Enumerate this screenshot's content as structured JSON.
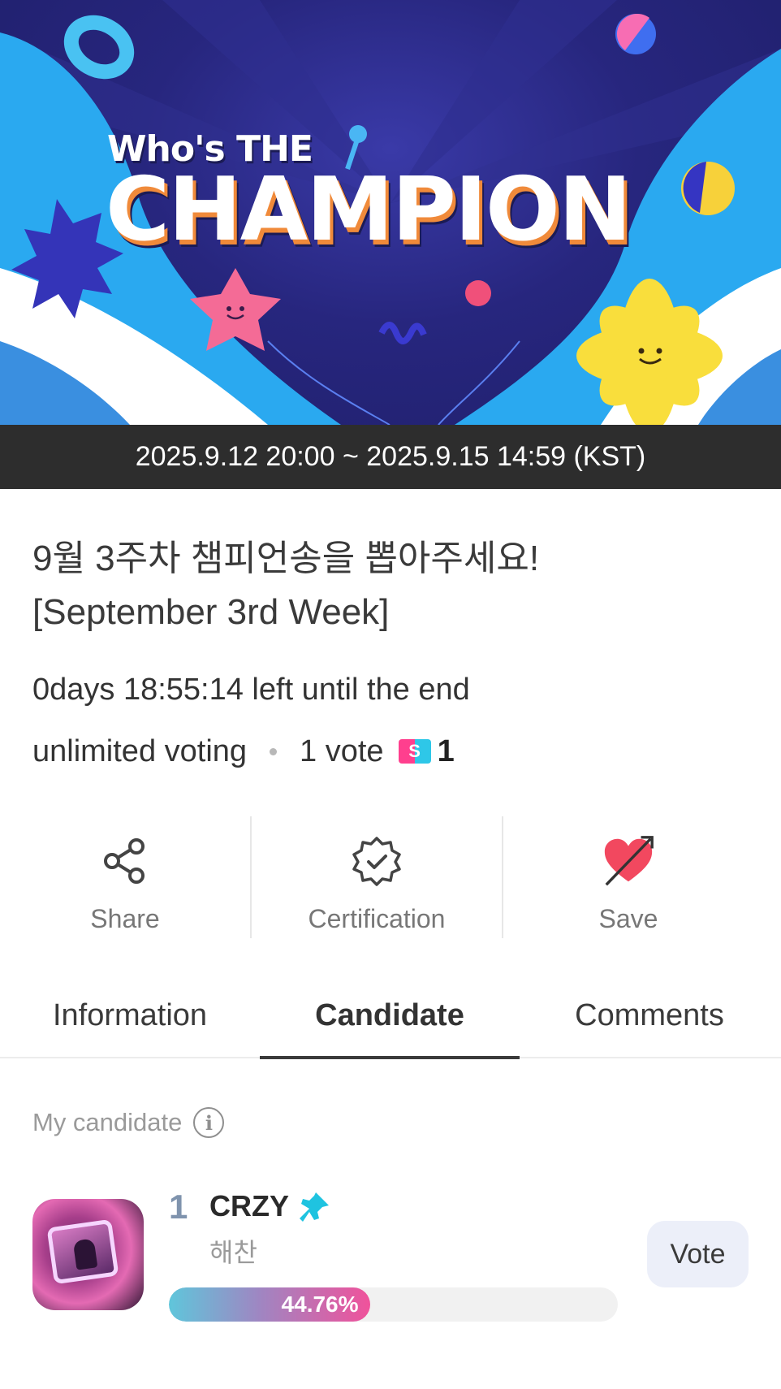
{
  "banner": {
    "subtitle": "Who's THE",
    "title": "CHAMPION"
  },
  "date_range": "2025.9.12 20:00 ~ 2025.9.15 14:59 (KST)",
  "vote_title": {
    "line1": "9월 3주차 챔피언송을 뽑아주세요!",
    "line2": "[September 3rd Week]"
  },
  "countdown": "0days 18:55:14 left until the end",
  "voting": {
    "mode": "unlimited voting",
    "cost": "1 vote",
    "ticket_glyph": "S",
    "ticket_count": "1"
  },
  "actions": {
    "share": "Share",
    "certification": "Certification",
    "save": "Save"
  },
  "tabs": [
    "Information",
    "Candidate",
    "Comments"
  ],
  "active_tab": "Candidate",
  "my_candidate": {
    "label": "My candidate",
    "info_glyph": "i"
  },
  "candidate": {
    "rank": "1",
    "song": "CRZY",
    "artist": "해찬",
    "percent": 44.76,
    "percent_label": "44.76%",
    "vote_button": "Vote"
  },
  "colors": {
    "date_bar": "#2d2d2d",
    "pink": "#f0529b",
    "cyan": "#5fc6db",
    "heart": "#f2485f",
    "vote_button_bg": "#eceff9"
  }
}
